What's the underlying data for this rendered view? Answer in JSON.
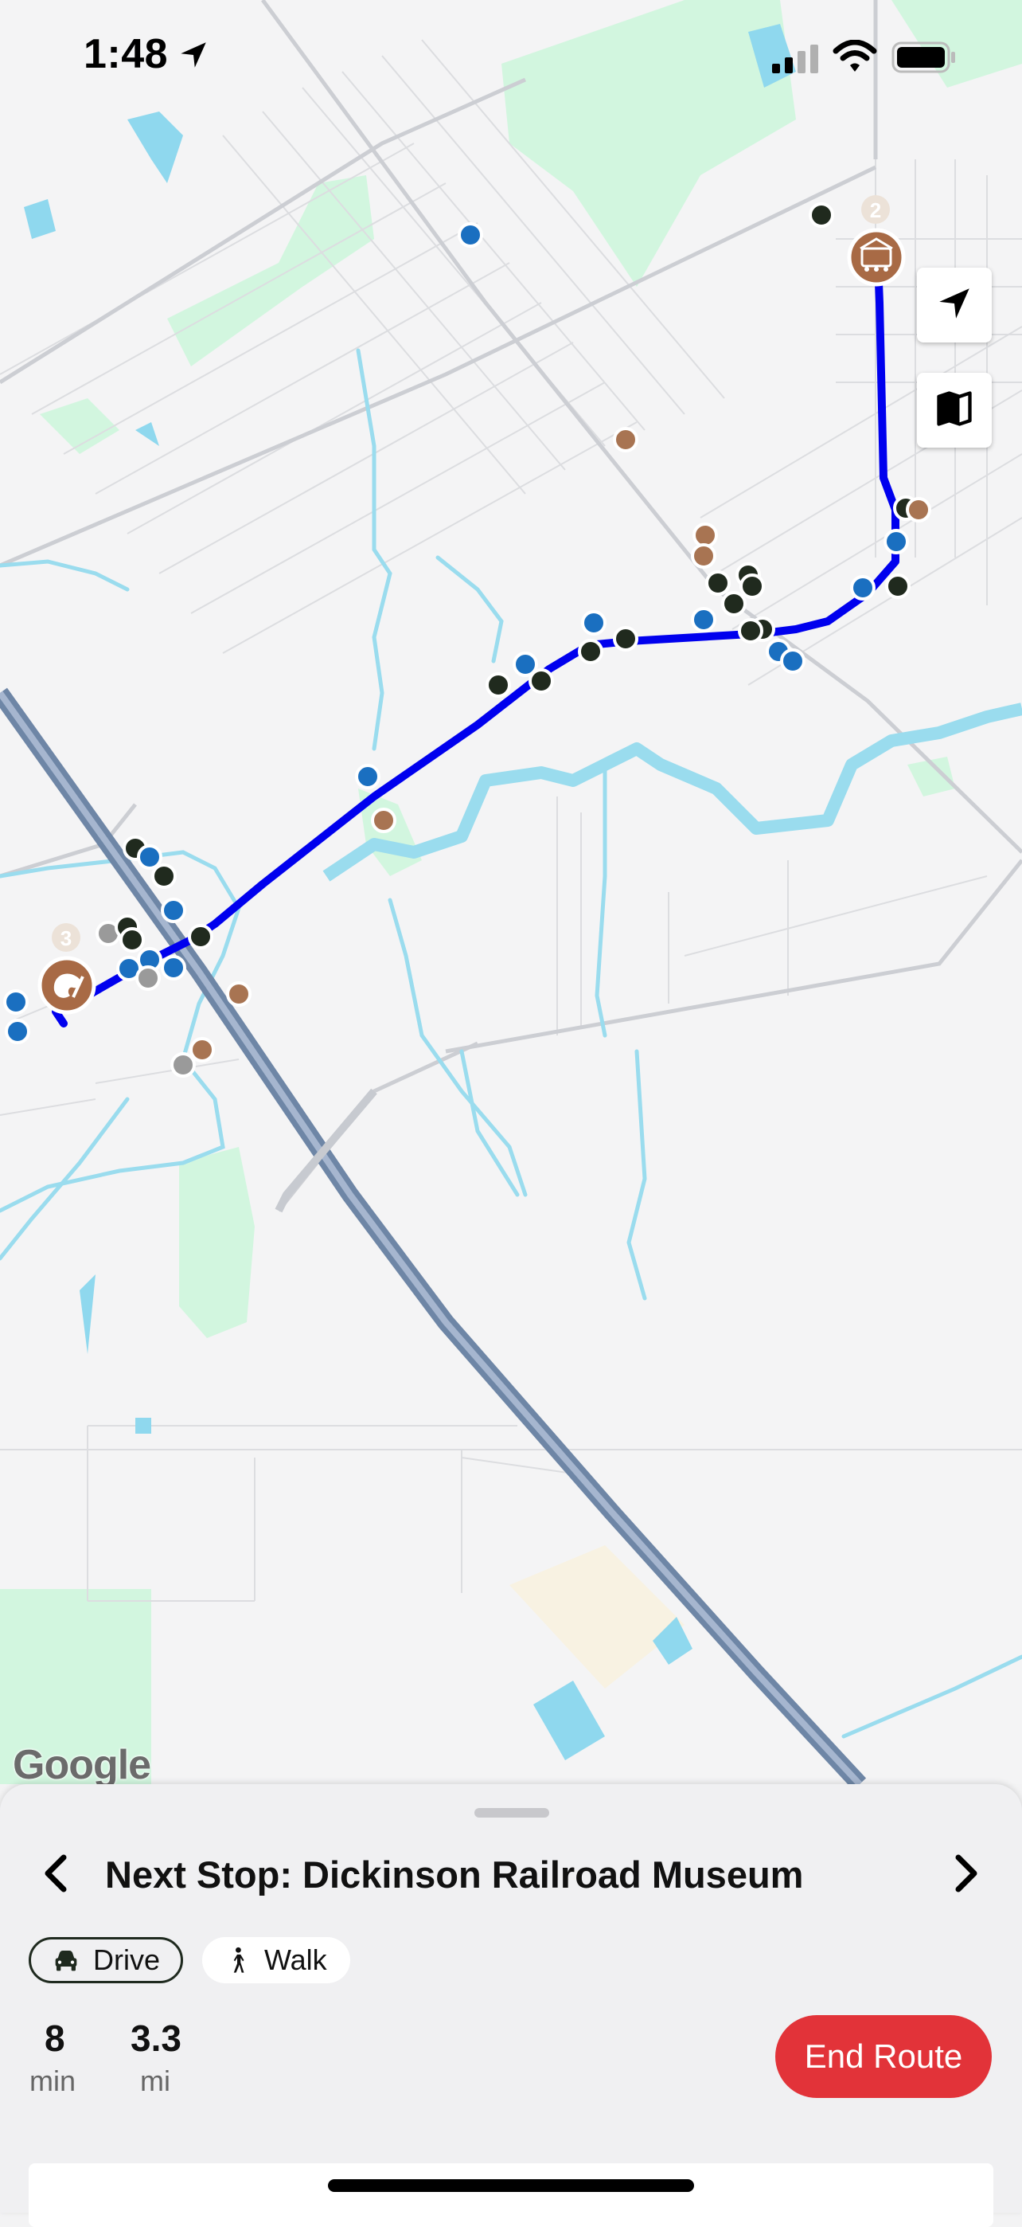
{
  "status_bar": {
    "time": "1:48",
    "location_icon": "location-arrow-icon",
    "signal_icon": "cellular-signal-icon",
    "wifi_icon": "wifi-icon",
    "battery_icon": "battery-icon"
  },
  "map": {
    "attribution": "Google",
    "route_color": "#0000ee",
    "controls": [
      {
        "name": "recenter-location-button",
        "icon": "location-arrow-icon"
      },
      {
        "name": "map-type-button",
        "icon": "map-icon"
      }
    ],
    "stops": [
      {
        "number": "2",
        "icon": "railroad-museum-icon",
        "color": "#a86a45"
      },
      {
        "number": "3",
        "icon": "art-palette-icon",
        "color": "#a86a45"
      }
    ]
  },
  "sheet": {
    "prev_icon": "chevron-left-icon",
    "next_icon": "chevron-right-icon",
    "next_stop": "Next Stop: Dickinson Railroad Museum",
    "modes": [
      {
        "label": "Drive",
        "icon": "car-icon",
        "selected": true
      },
      {
        "label": "Walk",
        "icon": "walking-person-icon",
        "selected": false
      }
    ],
    "duration_value": "8",
    "duration_unit": "min",
    "distance_value": "3.3",
    "distance_unit": "mi",
    "end_route_label": "End Route",
    "end_route_color": "#e23339"
  }
}
